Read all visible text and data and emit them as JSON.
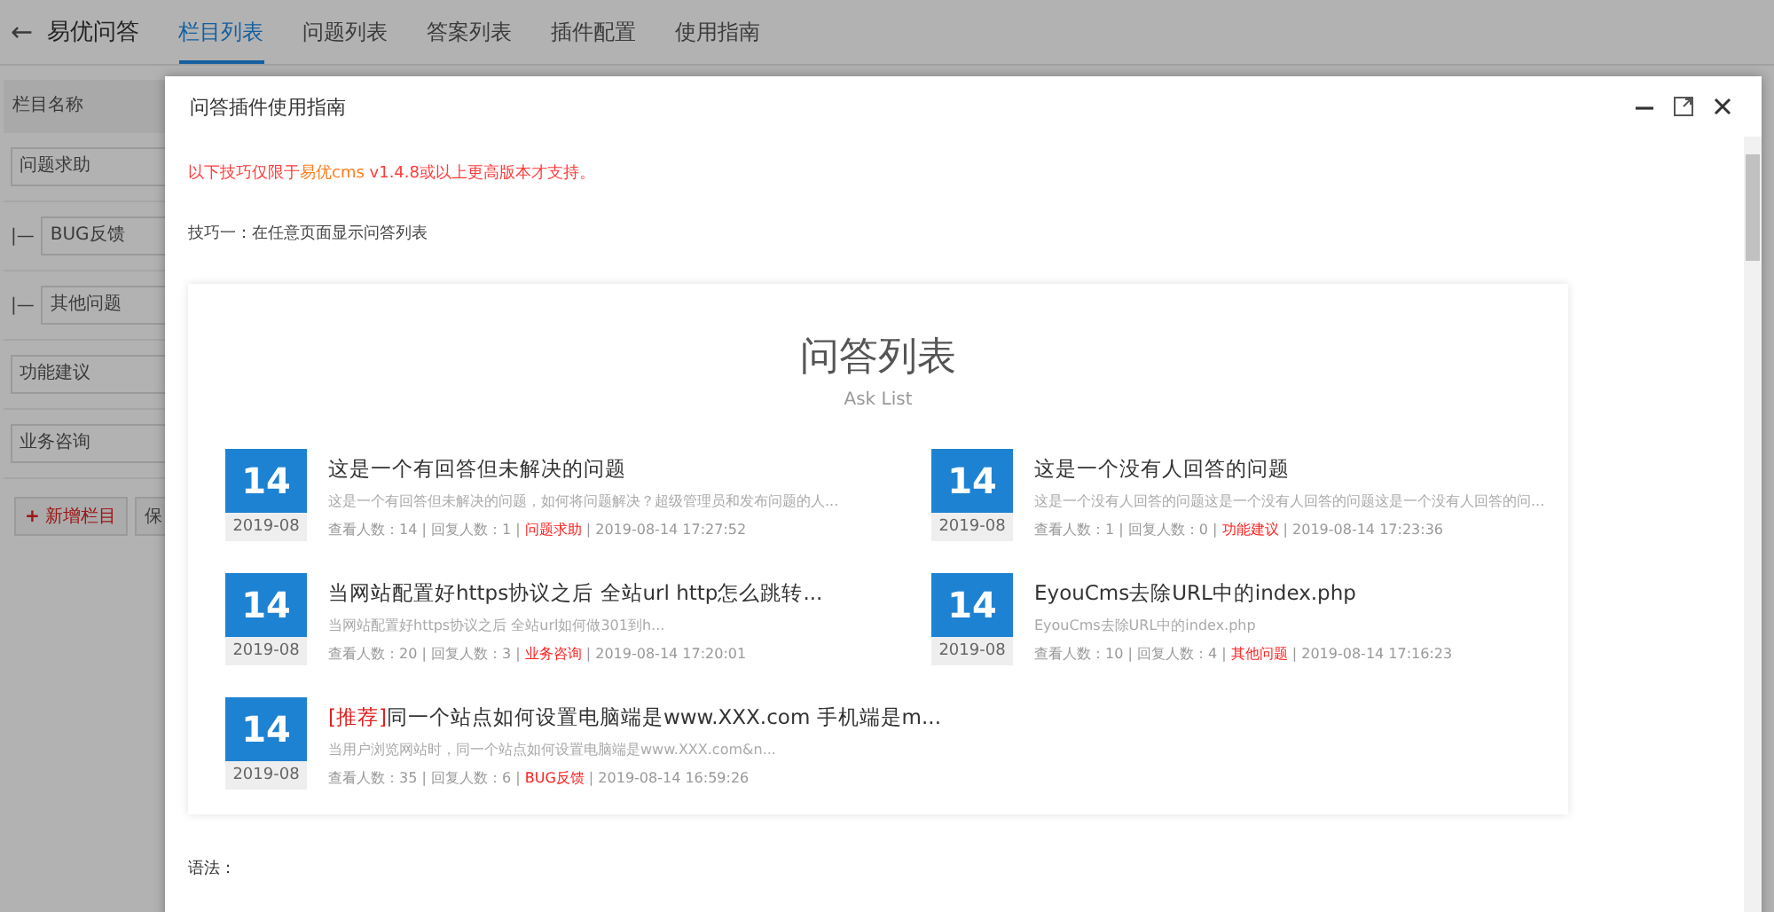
{
  "header": {
    "back": "←",
    "title": "易优问答",
    "tabs": [
      {
        "label": "栏目列表",
        "selected": true
      },
      {
        "label": "问题列表",
        "selected": false
      },
      {
        "label": "答案列表",
        "selected": false
      },
      {
        "label": "插件配置",
        "selected": false
      },
      {
        "label": "使用指南",
        "selected": false
      }
    ]
  },
  "table": {
    "column": "栏目名称",
    "rows": [
      {
        "name": "问题求助"
      },
      {
        "name": "BUG反馈",
        "prefix": "|—"
      },
      {
        "name": "其他问题",
        "prefix": "|—"
      },
      {
        "name": "功能建议"
      },
      {
        "name": "业务咨询"
      }
    ],
    "buttons": [
      {
        "label": "新增栏目",
        "icon": "+"
      },
      {
        "label": "保"
      }
    ]
  },
  "dialog": {
    "title": "问答插件使用指南",
    "notice": [
      {
        "text": "以下技巧仅限于",
        "kind": "red"
      },
      {
        "text": "易优cms",
        "kind": "orange"
      },
      {
        "text": " v1.4.8或以上更高版本才支持。",
        "kind": "red"
      }
    ],
    "tip": "技巧一：在任意页面显示问答列表",
    "preview": {
      "heading": "问答列表",
      "subheading": "Ask List",
      "items": [
        {
          "day": "14",
          "month": "2019-08",
          "title": "这是一个有回答但未解决的问题",
          "desc": "这是一个有回答但未解决的问题，如何将问题解决？超级管理员和发布问题的人...",
          "views": "查看人数：14 | 回复人数：1 | ",
          "category": "问题求助",
          "time": " | 2019-08-14 17:27:52"
        },
        {
          "day": "14",
          "month": "2019-08",
          "title": "这是一个没有人回答的问题",
          "desc": "这是一个没有人回答的问题这是一个没有人回答的问题这是一个没有人回答的问...",
          "views": "查看人数：1 | 回复人数：0 | ",
          "category": "功能建议",
          "time": " | 2019-08-14 17:23:36"
        },
        {
          "day": "14",
          "month": "2019-08",
          "title": "当网站配置好https协议之后 全站url http怎么跳转...",
          "desc": "当网站配置好https协议之后  全站url如何做301到h...",
          "views": "查看人数：20 | 回复人数：3 | ",
          "category": "业务咨询",
          "time": " | 2019-08-14 17:20:01"
        },
        {
          "day": "14",
          "month": "2019-08",
          "title": "EyouCms去除URL中的index.php",
          "desc": "EyouCms去除URL中的index.php",
          "views": "查看人数：10 | 回复人数：4 | ",
          "category": "其他问题",
          "time": " | 2019-08-14 17:16:23"
        },
        {
          "day": "14",
          "month": "2019-08",
          "tag": "[推荐]",
          "title": "同一个站点如何设置电脑端是www.XXX.com 手机端是m...",
          "desc": "当用户浏览网站时，同一个站点如何设置电脑端是www.XXX.com&n...",
          "views": "查看人数：35 | 回复人数：6 | ",
          "category": "BUG反馈",
          "time": " | 2019-08-14 16:59:26"
        }
      ]
    },
    "syntax": "语法："
  }
}
